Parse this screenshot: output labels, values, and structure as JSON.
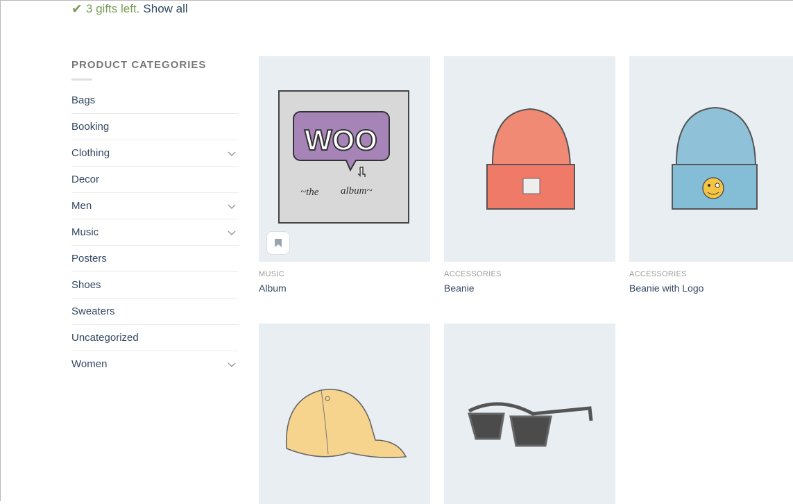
{
  "notice": {
    "gifts_text": "3 gifts left.",
    "link_text": "Show all"
  },
  "sidebar": {
    "title": "PRODUCT CATEGORIES",
    "items": [
      {
        "label": "Bags",
        "expandable": false
      },
      {
        "label": "Booking",
        "expandable": false
      },
      {
        "label": "Clothing",
        "expandable": true
      },
      {
        "label": "Decor",
        "expandable": false
      },
      {
        "label": "Men",
        "expandable": true
      },
      {
        "label": "Music",
        "expandable": true
      },
      {
        "label": "Posters",
        "expandable": false
      },
      {
        "label": "Shoes",
        "expandable": false
      },
      {
        "label": "Sweaters",
        "expandable": false
      },
      {
        "label": "Uncategorized",
        "expandable": false
      },
      {
        "label": "Women",
        "expandable": true
      }
    ]
  },
  "products": [
    {
      "category": "MUSIC",
      "title": "Album",
      "image": "woo-album-icon"
    },
    {
      "category": "ACCESSORIES",
      "title": "Beanie",
      "image": "beanie-icon"
    },
    {
      "category": "ACCESSORIES",
      "title": "Beanie with Logo",
      "image": "beanie-logo-icon"
    },
    {
      "category": "",
      "title": "",
      "image": "cap-icon"
    },
    {
      "category": "",
      "title": "",
      "image": "sunglasses-icon"
    }
  ],
  "colors": {
    "accent_green": "#7a9c59",
    "link": "#334862",
    "thumb_bg": "#e9eef2"
  }
}
